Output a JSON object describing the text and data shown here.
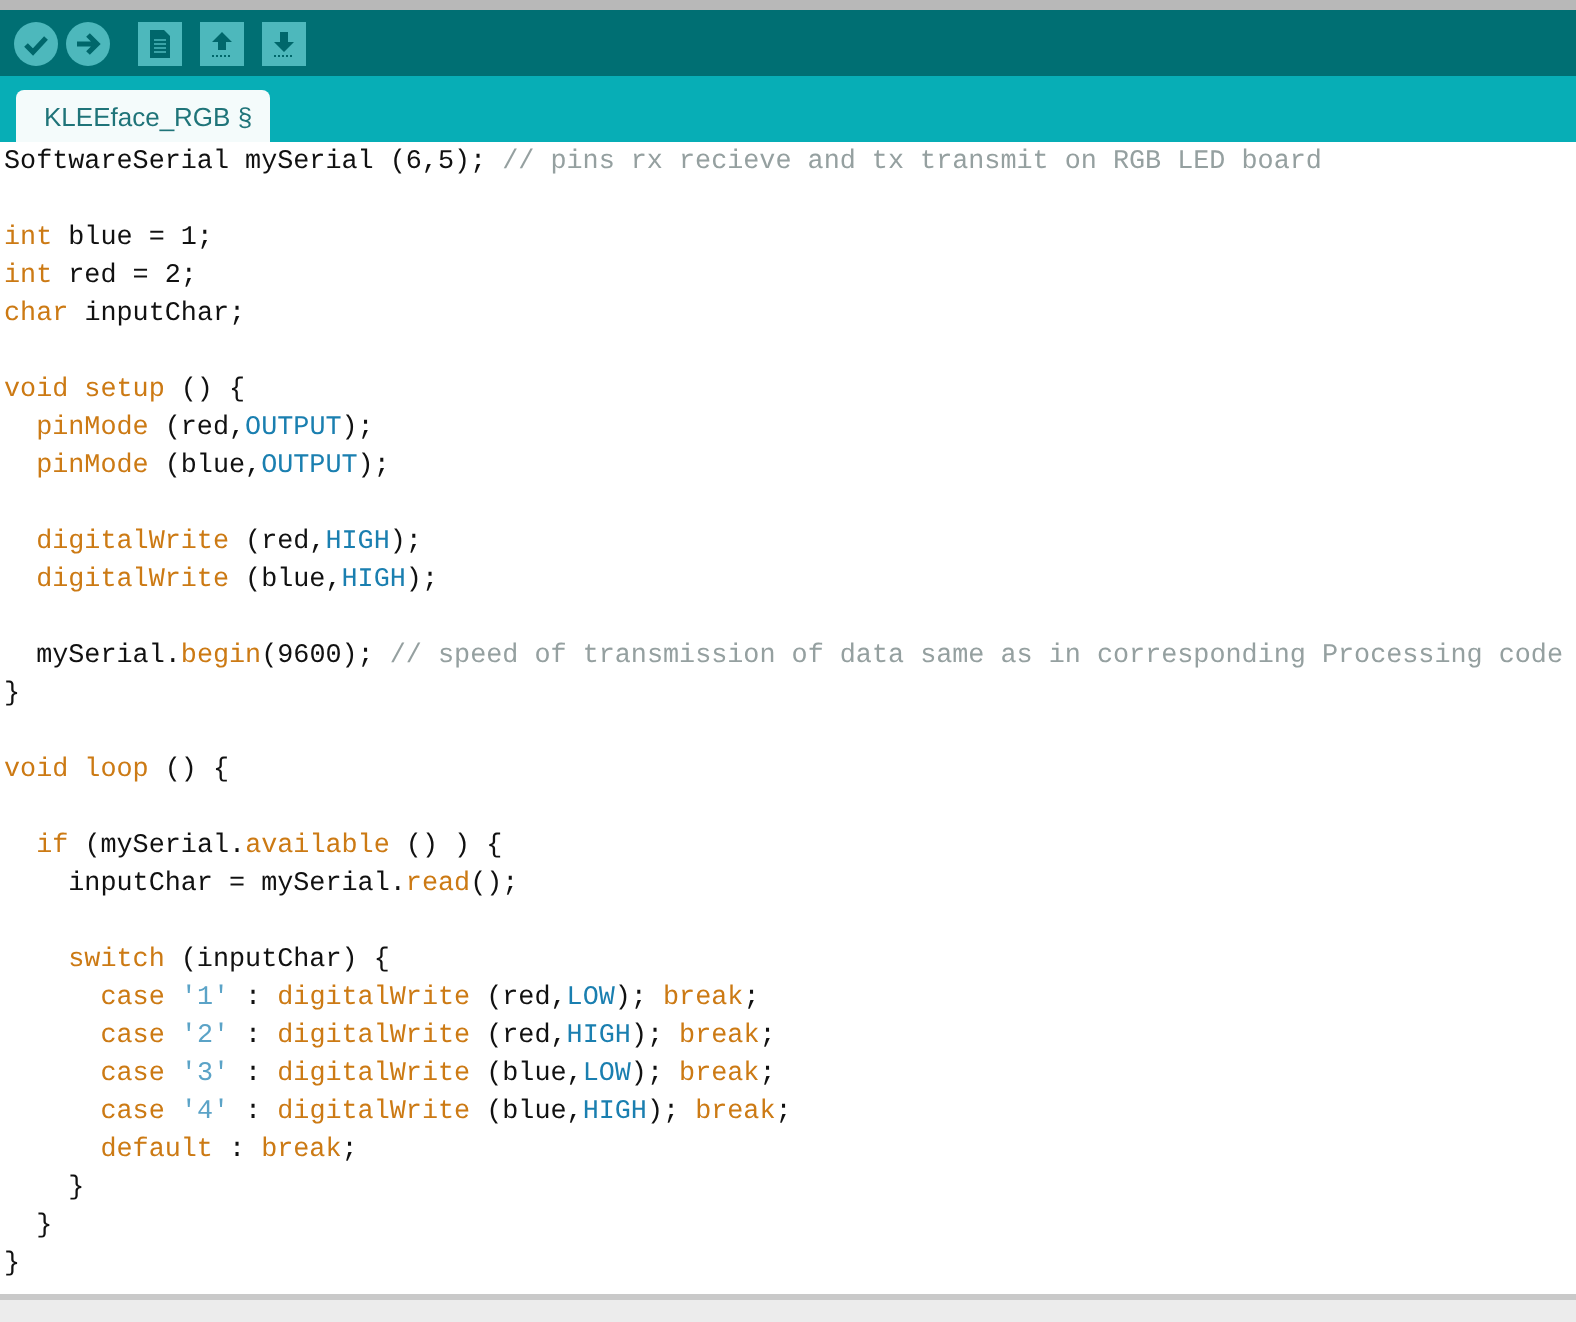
{
  "tabs": [
    {
      "label": "KLEEface_RGB §",
      "selected": true
    }
  ],
  "code": [
    {
      "kind": "code",
      "tokens": [
        {
          "text": "SoftwareSerial mySerial (6,5); ",
          "kind": "plain"
        },
        {
          "text": "// pins rx recieve and tx transmit on RGB LED board",
          "kind": "comment"
        }
      ]
    },
    {
      "kind": "blank"
    },
    {
      "kind": "code",
      "tokens": [
        {
          "text": "int",
          "kind": "keyword"
        },
        {
          "text": " blue = 1;",
          "kind": "plain"
        }
      ]
    },
    {
      "kind": "code",
      "tokens": [
        {
          "text": "int",
          "kind": "keyword"
        },
        {
          "text": " red = 2;",
          "kind": "plain"
        }
      ]
    },
    {
      "kind": "code",
      "tokens": [
        {
          "text": "char",
          "kind": "keyword"
        },
        {
          "text": " inputChar;",
          "kind": "plain"
        }
      ]
    },
    {
      "kind": "blank"
    },
    {
      "kind": "code",
      "tokens": [
        {
          "text": "void setup",
          "kind": "keyword"
        },
        {
          "text": " () {",
          "kind": "plain"
        }
      ]
    },
    {
      "kind": "code",
      "tokens": [
        {
          "text": "  pinMode",
          "kind": "keyword"
        },
        {
          "text": " (red,",
          "kind": "plain"
        },
        {
          "text": "OUTPUT",
          "kind": "constant"
        },
        {
          "text": ");",
          "kind": "plain"
        }
      ]
    },
    {
      "kind": "code",
      "tokens": [
        {
          "text": "  pinMode",
          "kind": "keyword"
        },
        {
          "text": " (blue,",
          "kind": "plain"
        },
        {
          "text": "OUTPUT",
          "kind": "constant"
        },
        {
          "text": ");",
          "kind": "plain"
        }
      ]
    },
    {
      "kind": "blank"
    },
    {
      "kind": "code",
      "tokens": [
        {
          "text": "  digitalWrite",
          "kind": "keyword"
        },
        {
          "text": " (red,",
          "kind": "plain"
        },
        {
          "text": "HIGH",
          "kind": "constant"
        },
        {
          "text": ");",
          "kind": "plain"
        }
      ]
    },
    {
      "kind": "code",
      "tokens": [
        {
          "text": "  digitalWrite",
          "kind": "keyword"
        },
        {
          "text": " (blue,",
          "kind": "plain"
        },
        {
          "text": "HIGH",
          "kind": "constant"
        },
        {
          "text": ");",
          "kind": "plain"
        }
      ]
    },
    {
      "kind": "blank"
    },
    {
      "kind": "code",
      "tokens": [
        {
          "text": "  mySerial.",
          "kind": "plain"
        },
        {
          "text": "begin",
          "kind": "keyword"
        },
        {
          "text": "(9600); ",
          "kind": "plain"
        },
        {
          "text": "// speed of transmission of data same as in corresponding Processing code",
          "kind": "comment"
        }
      ]
    },
    {
      "kind": "code",
      "tokens": [
        {
          "text": "}",
          "kind": "plain"
        }
      ]
    },
    {
      "kind": "blank"
    },
    {
      "kind": "code",
      "tokens": [
        {
          "text": "void loop",
          "kind": "keyword"
        },
        {
          "text": " () {",
          "kind": "plain"
        }
      ]
    },
    {
      "kind": "blank"
    },
    {
      "kind": "code",
      "tokens": [
        {
          "text": "  if",
          "kind": "keyword"
        },
        {
          "text": " (mySerial.",
          "kind": "plain"
        },
        {
          "text": "available",
          "kind": "keyword"
        },
        {
          "text": " () ) {",
          "kind": "plain"
        }
      ]
    },
    {
      "kind": "code",
      "tokens": [
        {
          "text": "    inputChar = mySerial.",
          "kind": "plain"
        },
        {
          "text": "read",
          "kind": "keyword"
        },
        {
          "text": "();",
          "kind": "plain"
        }
      ]
    },
    {
      "kind": "blank"
    },
    {
      "kind": "code",
      "tokens": [
        {
          "text": "    switch",
          "kind": "keyword"
        },
        {
          "text": " (inputChar) {",
          "kind": "plain"
        }
      ]
    },
    {
      "kind": "code",
      "tokens": [
        {
          "text": "      case ",
          "kind": "keyword"
        },
        {
          "text": "'1'",
          "kind": "string"
        },
        {
          "text": " : ",
          "kind": "plain"
        },
        {
          "text": "digitalWrite",
          "kind": "keyword"
        },
        {
          "text": " (red,",
          "kind": "plain"
        },
        {
          "text": "LOW",
          "kind": "constant"
        },
        {
          "text": "); ",
          "kind": "plain"
        },
        {
          "text": "break",
          "kind": "keyword"
        },
        {
          "text": ";",
          "kind": "plain"
        }
      ]
    },
    {
      "kind": "code",
      "tokens": [
        {
          "text": "      case ",
          "kind": "keyword"
        },
        {
          "text": "'2'",
          "kind": "string"
        },
        {
          "text": " : ",
          "kind": "plain"
        },
        {
          "text": "digitalWrite",
          "kind": "keyword"
        },
        {
          "text": " (red,",
          "kind": "plain"
        },
        {
          "text": "HIGH",
          "kind": "constant"
        },
        {
          "text": "); ",
          "kind": "plain"
        },
        {
          "text": "break",
          "kind": "keyword"
        },
        {
          "text": ";",
          "kind": "plain"
        }
      ]
    },
    {
      "kind": "code",
      "tokens": [
        {
          "text": "      case ",
          "kind": "keyword"
        },
        {
          "text": "'3'",
          "kind": "string"
        },
        {
          "text": " : ",
          "kind": "plain"
        },
        {
          "text": "digitalWrite",
          "kind": "keyword"
        },
        {
          "text": " (blue,",
          "kind": "plain"
        },
        {
          "text": "LOW",
          "kind": "constant"
        },
        {
          "text": "); ",
          "kind": "plain"
        },
        {
          "text": "break",
          "kind": "keyword"
        },
        {
          "text": ";",
          "kind": "plain"
        }
      ]
    },
    {
      "kind": "code",
      "tokens": [
        {
          "text": "      case ",
          "kind": "keyword"
        },
        {
          "text": "'4'",
          "kind": "string"
        },
        {
          "text": " : ",
          "kind": "plain"
        },
        {
          "text": "digitalWrite",
          "kind": "keyword"
        },
        {
          "text": " (blue,",
          "kind": "plain"
        },
        {
          "text": "HIGH",
          "kind": "constant"
        },
        {
          "text": "); ",
          "kind": "plain"
        },
        {
          "text": "break",
          "kind": "keyword"
        },
        {
          "text": ";",
          "kind": "plain"
        }
      ]
    },
    {
      "kind": "code",
      "tokens": [
        {
          "text": "      default",
          "kind": "keyword"
        },
        {
          "text": " : ",
          "kind": "plain"
        },
        {
          "text": "break",
          "kind": "keyword"
        },
        {
          "text": ";",
          "kind": "plain"
        }
      ]
    },
    {
      "kind": "code",
      "tokens": [
        {
          "text": "    }",
          "kind": "plain"
        }
      ]
    },
    {
      "kind": "code",
      "tokens": [
        {
          "text": "  }",
          "kind": "plain"
        }
      ]
    },
    {
      "kind": "code",
      "tokens": [
        {
          "text": "}",
          "kind": "plain"
        }
      ]
    }
  ]
}
